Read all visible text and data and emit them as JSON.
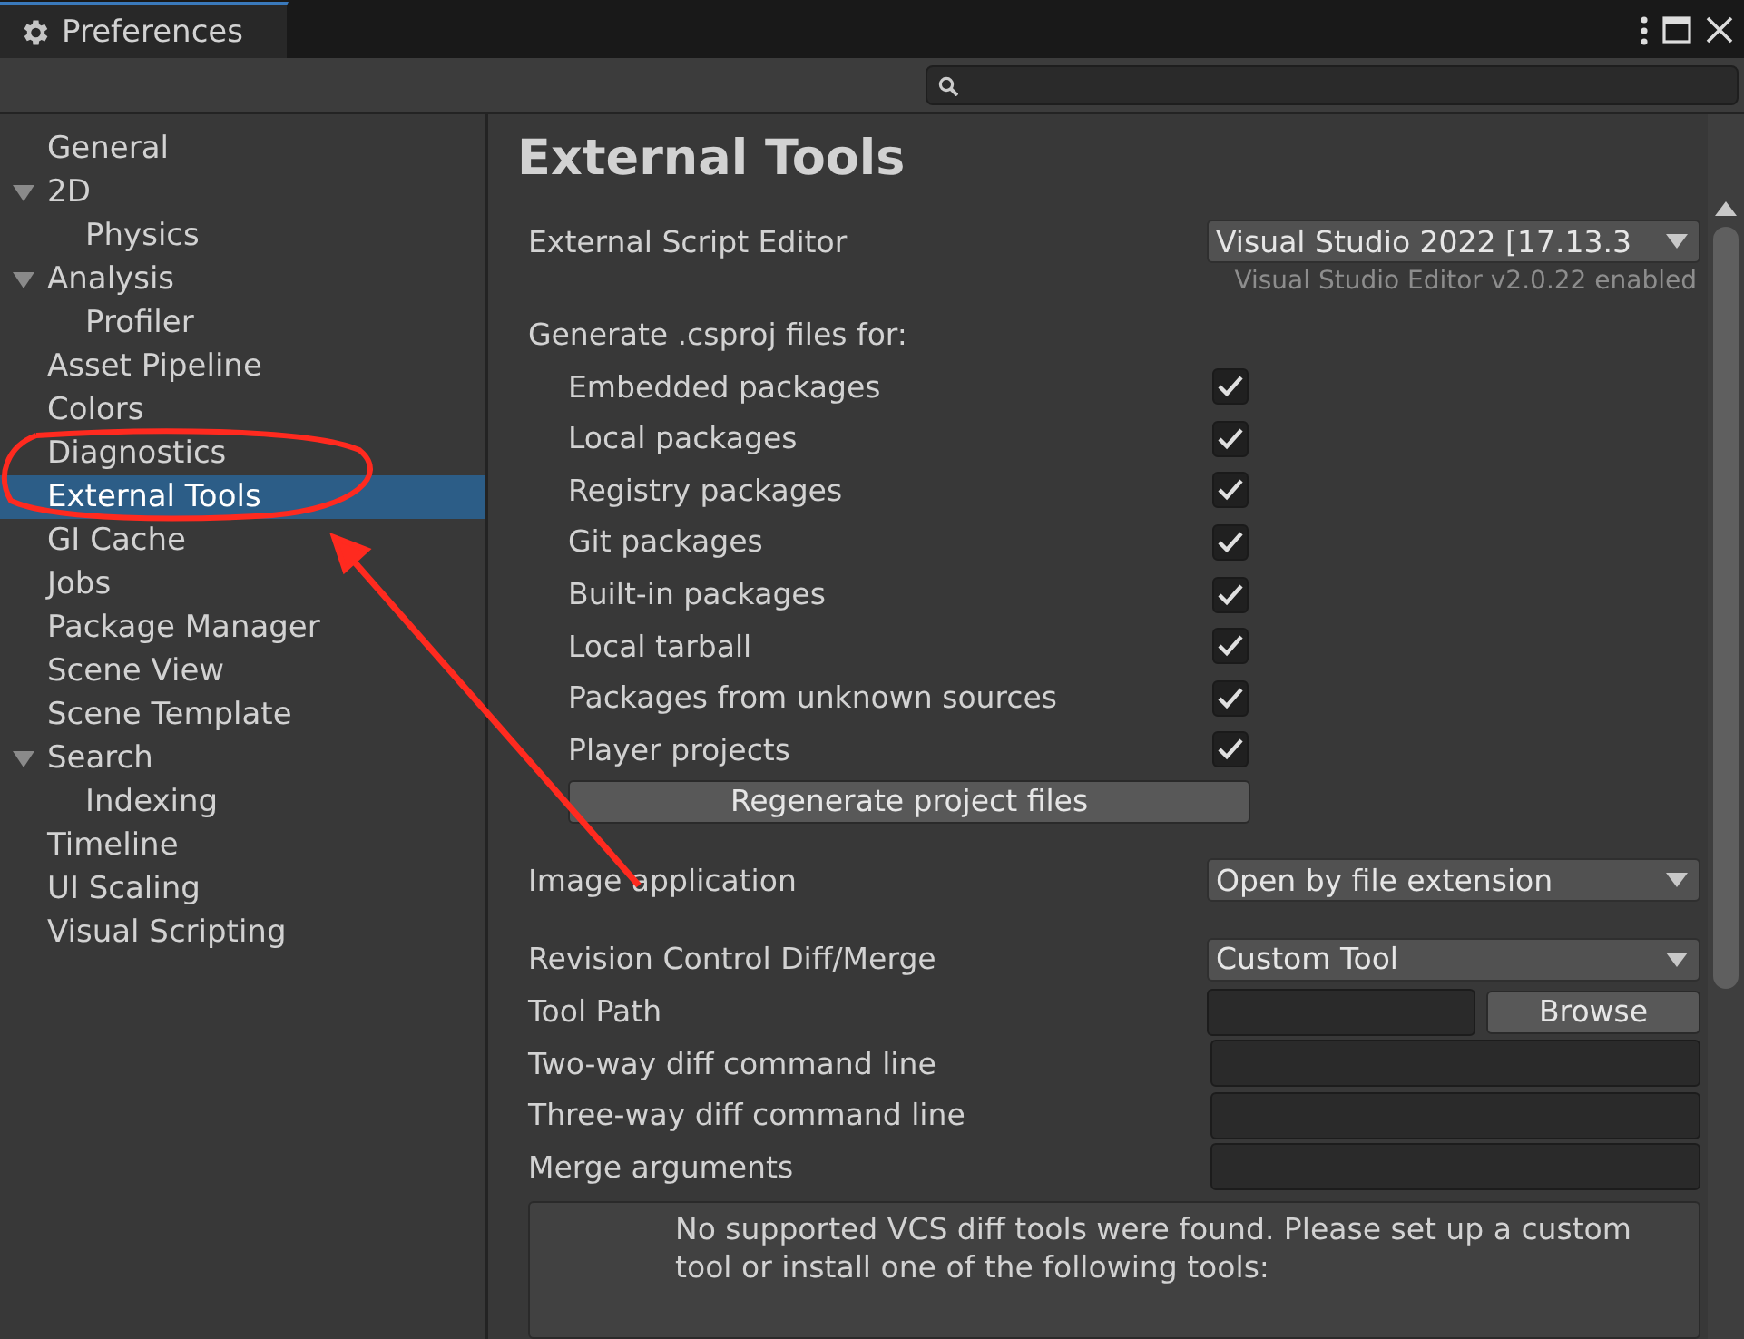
{
  "window": {
    "title": "Preferences"
  },
  "sidebar": {
    "items": [
      {
        "label": "General",
        "selected": false
      },
      {
        "label": "2D",
        "selected": false,
        "expanded": true,
        "children": [
          {
            "label": "Physics",
            "selected": false
          }
        ]
      },
      {
        "label": "Analysis",
        "selected": false,
        "expanded": true,
        "children": [
          {
            "label": "Profiler",
            "selected": false
          }
        ]
      },
      {
        "label": "Asset Pipeline",
        "selected": false
      },
      {
        "label": "Colors",
        "selected": false
      },
      {
        "label": "Diagnostics",
        "selected": false
      },
      {
        "label": "External Tools",
        "selected": true
      },
      {
        "label": "GI Cache",
        "selected": false
      },
      {
        "label": "Jobs",
        "selected": false
      },
      {
        "label": "Package Manager",
        "selected": false
      },
      {
        "label": "Scene View",
        "selected": false
      },
      {
        "label": "Scene Template",
        "selected": false
      },
      {
        "label": "Search",
        "selected": false,
        "expanded": true,
        "children": [
          {
            "label": "Indexing",
            "selected": false
          }
        ]
      },
      {
        "label": "Timeline",
        "selected": false
      },
      {
        "label": "UI Scaling",
        "selected": false
      },
      {
        "label": "Visual Scripting",
        "selected": false
      }
    ]
  },
  "page": {
    "title": "External Tools",
    "settings": [
      {
        "kind": "dropdown",
        "label": "External Script Editor",
        "value": "Visual Studio 2022 [17.13.3",
        "note": "Visual Studio Editor v2.0.22 enabled"
      },
      {
        "kind": "heading",
        "label": "Generate .csproj files for:"
      },
      {
        "kind": "checkbox",
        "label": "Embedded packages",
        "checked": true
      },
      {
        "kind": "checkbox",
        "label": "Local packages",
        "checked": true
      },
      {
        "kind": "checkbox",
        "label": "Registry packages",
        "checked": true
      },
      {
        "kind": "checkbox",
        "label": "Git packages",
        "checked": true
      },
      {
        "kind": "checkbox",
        "label": "Built-in packages",
        "checked": true
      },
      {
        "kind": "checkbox",
        "label": "Local tarball",
        "checked": true
      },
      {
        "kind": "checkbox",
        "label": "Packages from unknown sources",
        "checked": true
      },
      {
        "kind": "checkbox",
        "label": "Player projects",
        "checked": true
      },
      {
        "kind": "button",
        "label": "Regenerate project files"
      },
      {
        "kind": "dropdown",
        "label": "Image application",
        "value": "Open by file extension"
      },
      {
        "kind": "dropdown",
        "label": "Revision Control Diff/Merge",
        "value": "Custom Tool"
      },
      {
        "kind": "browse",
        "label": "Tool Path",
        "button": "Browse"
      },
      {
        "kind": "field",
        "label": "Two-way diff command line"
      },
      {
        "kind": "field",
        "label": "Three-way diff command line"
      },
      {
        "kind": "field",
        "label": "Merge arguments"
      },
      {
        "kind": "help",
        "text": "No supported VCS diff tools were found. Please set up a custom tool or install one of the following tools:"
      }
    ]
  }
}
